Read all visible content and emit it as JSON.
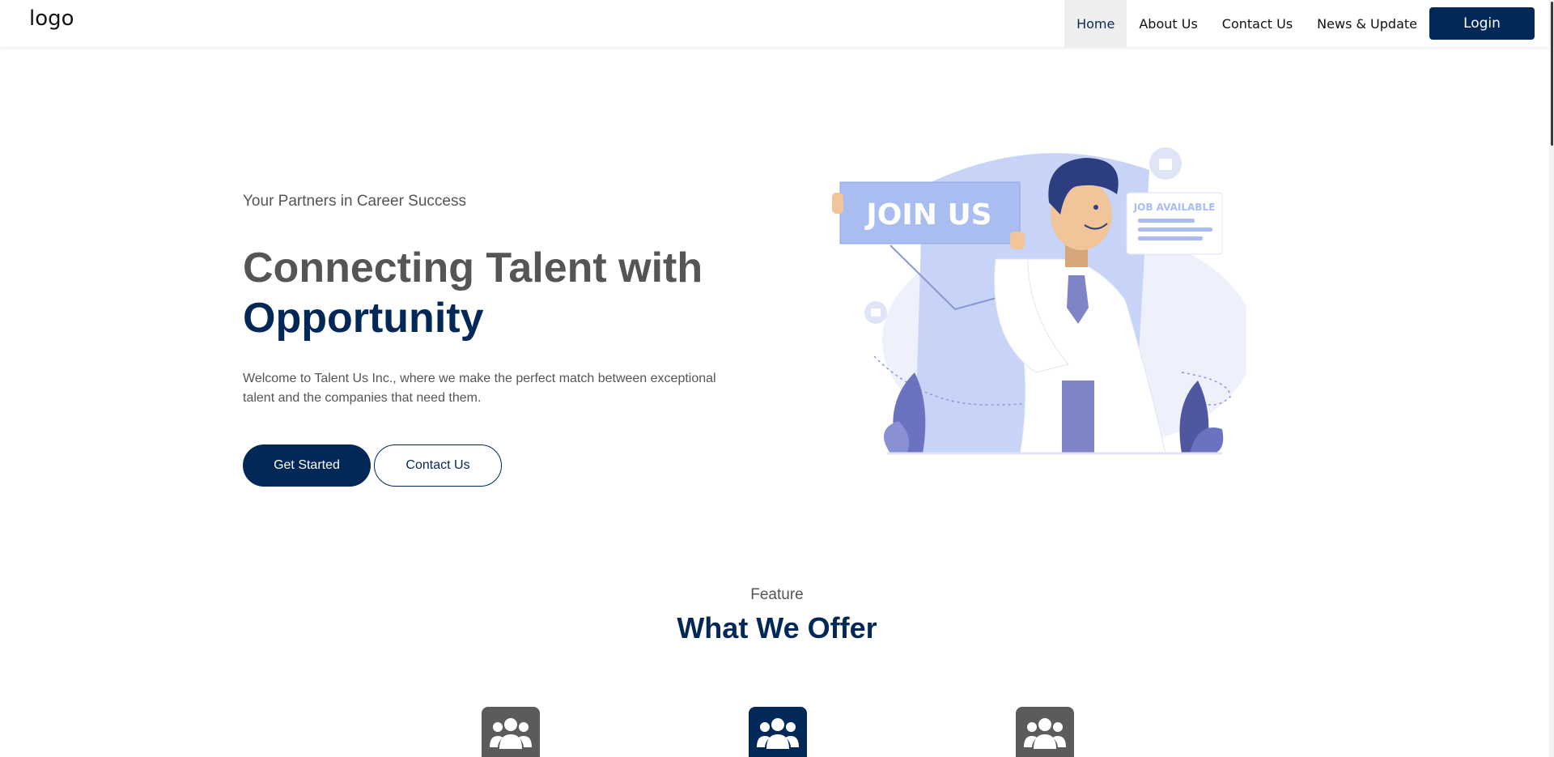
{
  "header": {
    "logo": "logo",
    "nav": [
      {
        "label": "Home",
        "active": true
      },
      {
        "label": "About Us",
        "active": false
      },
      {
        "label": "Contact Us",
        "active": false
      },
      {
        "label": "News & Update",
        "active": false
      }
    ],
    "login_label": "Login"
  },
  "hero": {
    "subtitle": "Your Partners in Career Success",
    "title_line1": "Connecting Talent with",
    "title_line2": "Opportunity",
    "description": "Welcome to Talent Us Inc., where we make the perfect match between exceptional talent and the companies that need them.",
    "primary_button": "Get Started",
    "secondary_button": "Contact Us",
    "illustration": {
      "sign_text": "JOIN US",
      "card_text": "JOB AVAILABLE"
    }
  },
  "features": {
    "label": "Feature",
    "title": "What We Offer",
    "icons": [
      {
        "icon": "users-icon",
        "color": "#5b5b5b"
      },
      {
        "icon": "users-icon",
        "color": "#022857"
      },
      {
        "icon": "users-icon",
        "color": "#5b5b5b"
      }
    ]
  },
  "colors": {
    "brand": "#022857",
    "text_gray": "#555555",
    "illustration_blue": "#c7d4f7"
  }
}
